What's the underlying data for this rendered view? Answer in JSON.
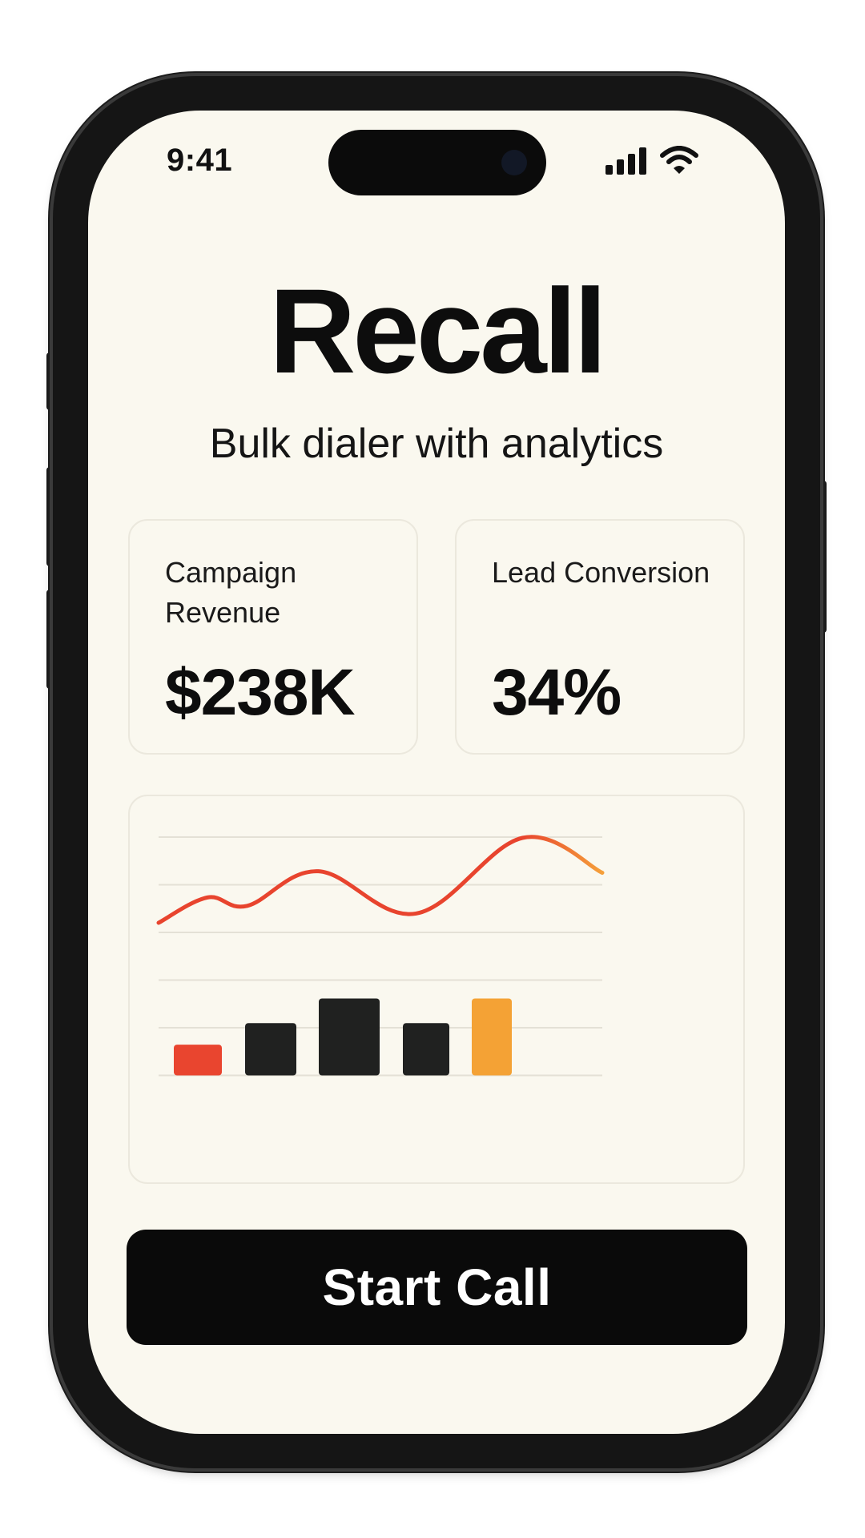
{
  "status_bar": {
    "time": "9:41",
    "icons": [
      "cellular-signal-icon",
      "wifi-icon"
    ]
  },
  "app": {
    "title": "Recall",
    "subtitle": "Bulk dialer with analytics"
  },
  "stats": [
    {
      "label": "Campaign Revenue",
      "value": "$238K"
    },
    {
      "label": "Lead Conversion",
      "value": "34%"
    }
  ],
  "chart_data": {
    "type": "line",
    "title": "",
    "xlabel": "",
    "ylabel": "",
    "grid": true,
    "grid_lines": 6,
    "line": {
      "values": [
        0.0,
        0.82,
        0.55,
        1.67,
        0.3,
        2.75,
        1.62
      ],
      "colors": [
        "#e8442e",
        "#f5a03a"
      ]
    },
    "bars": {
      "values": [
        0.4,
        0.68,
        1.0,
        0.68,
        1.0
      ],
      "colors": [
        "#e9452f",
        "#202120",
        "#202120",
        "#202120",
        "#f4a235"
      ]
    }
  },
  "cta": {
    "label": "Start Call"
  },
  "colors": {
    "background": "#faf8ef",
    "text": "#0d0d0d",
    "accent_red": "#e8442e",
    "accent_orange": "#f4a235",
    "button": "#0a0a0a"
  }
}
